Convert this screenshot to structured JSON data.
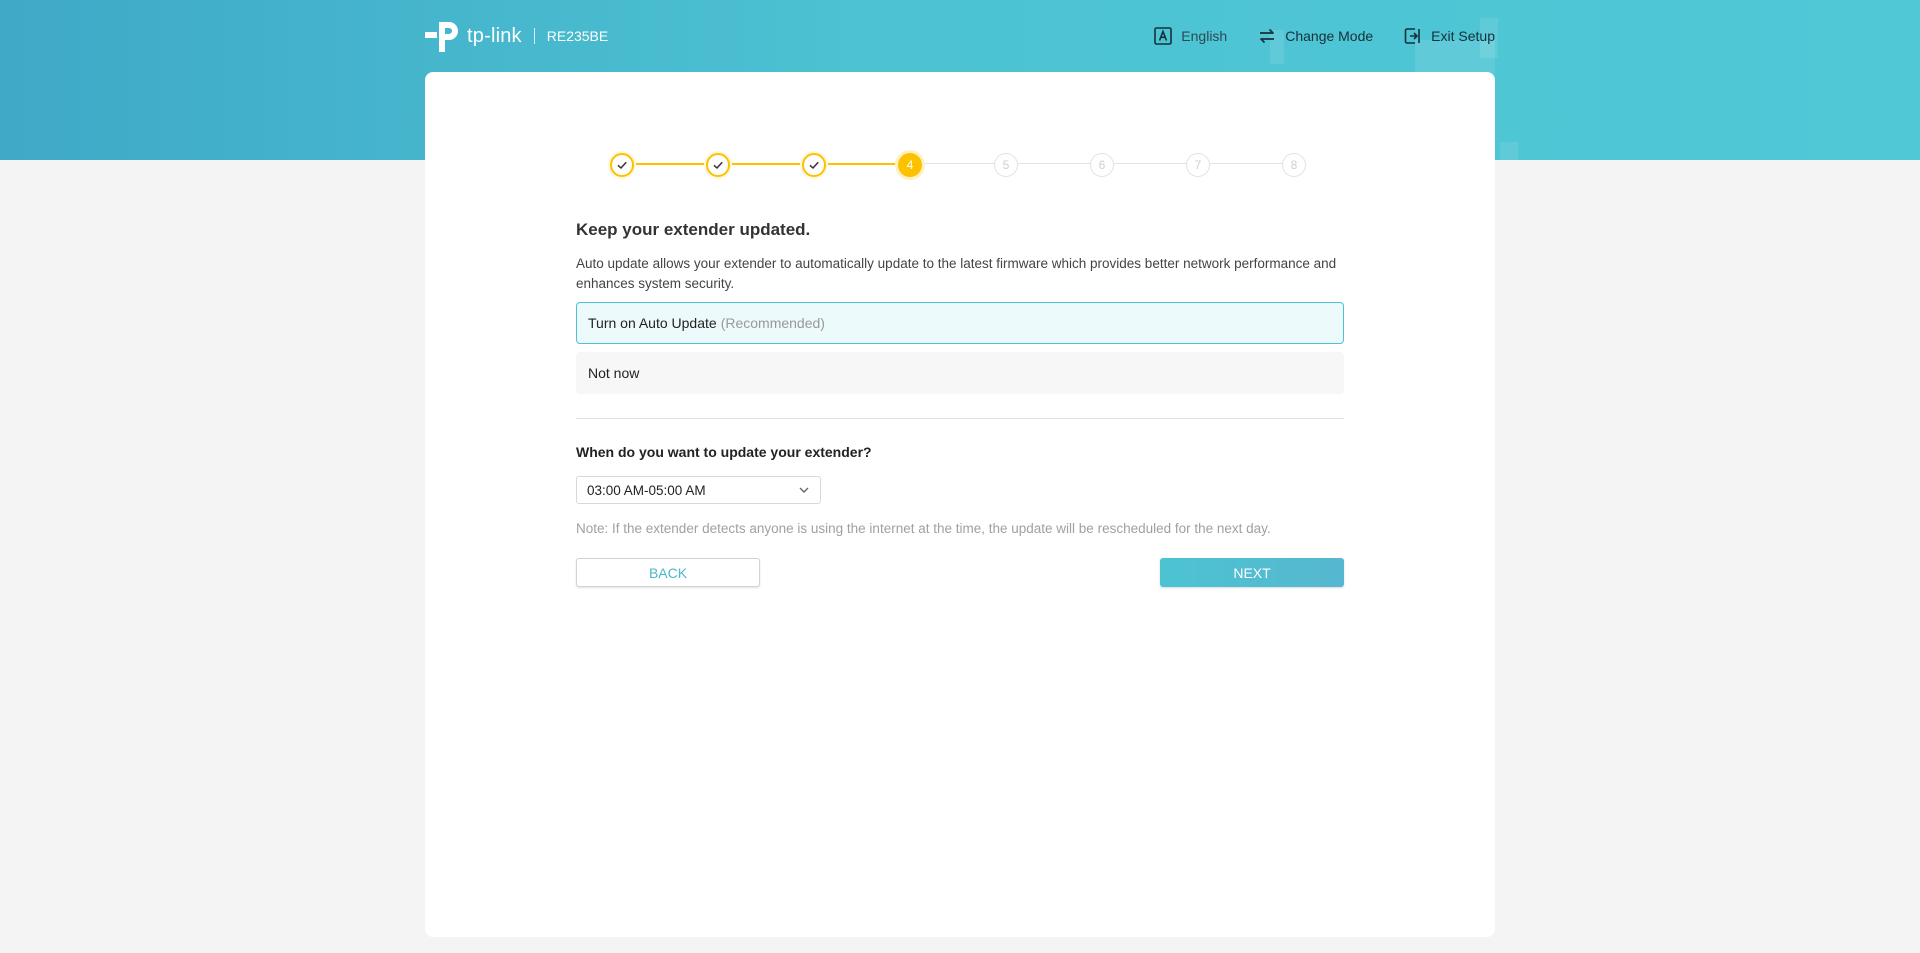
{
  "header": {
    "brand": "tp-link",
    "model": "RE235BE",
    "actions": {
      "language": "English",
      "change_mode": "Change Mode",
      "exit_setup": "Exit Setup"
    }
  },
  "stepper": {
    "current": 4,
    "total": 8,
    "steps": [
      {
        "label": "1",
        "state": "done"
      },
      {
        "label": "2",
        "state": "done"
      },
      {
        "label": "3",
        "state": "done"
      },
      {
        "label": "4",
        "state": "active"
      },
      {
        "label": "5",
        "state": "todo"
      },
      {
        "label": "6",
        "state": "todo"
      },
      {
        "label": "7",
        "state": "todo"
      },
      {
        "label": "8",
        "state": "todo"
      }
    ]
  },
  "content": {
    "title": "Keep your extender updated.",
    "description": "Auto update allows your extender to automatically update to the latest firmware which provides better network performance and enhances system security.",
    "options": [
      {
        "label": "Turn on Auto Update",
        "hint": "(Recommended)",
        "selected": true
      },
      {
        "label": "Not now",
        "selected": false
      }
    ],
    "schedule_question": "When do you want to update your extender?",
    "schedule_value": "03:00 AM-05:00 AM",
    "note": "Note: If the extender detects anyone is using the internet at the time, the update will be rescheduled for the next day."
  },
  "buttons": {
    "back": "BACK",
    "next": "NEXT"
  },
  "colors": {
    "accent": "#4cc2d2",
    "step_done": "#fcc200",
    "step_todo": "#e3e3e3"
  }
}
